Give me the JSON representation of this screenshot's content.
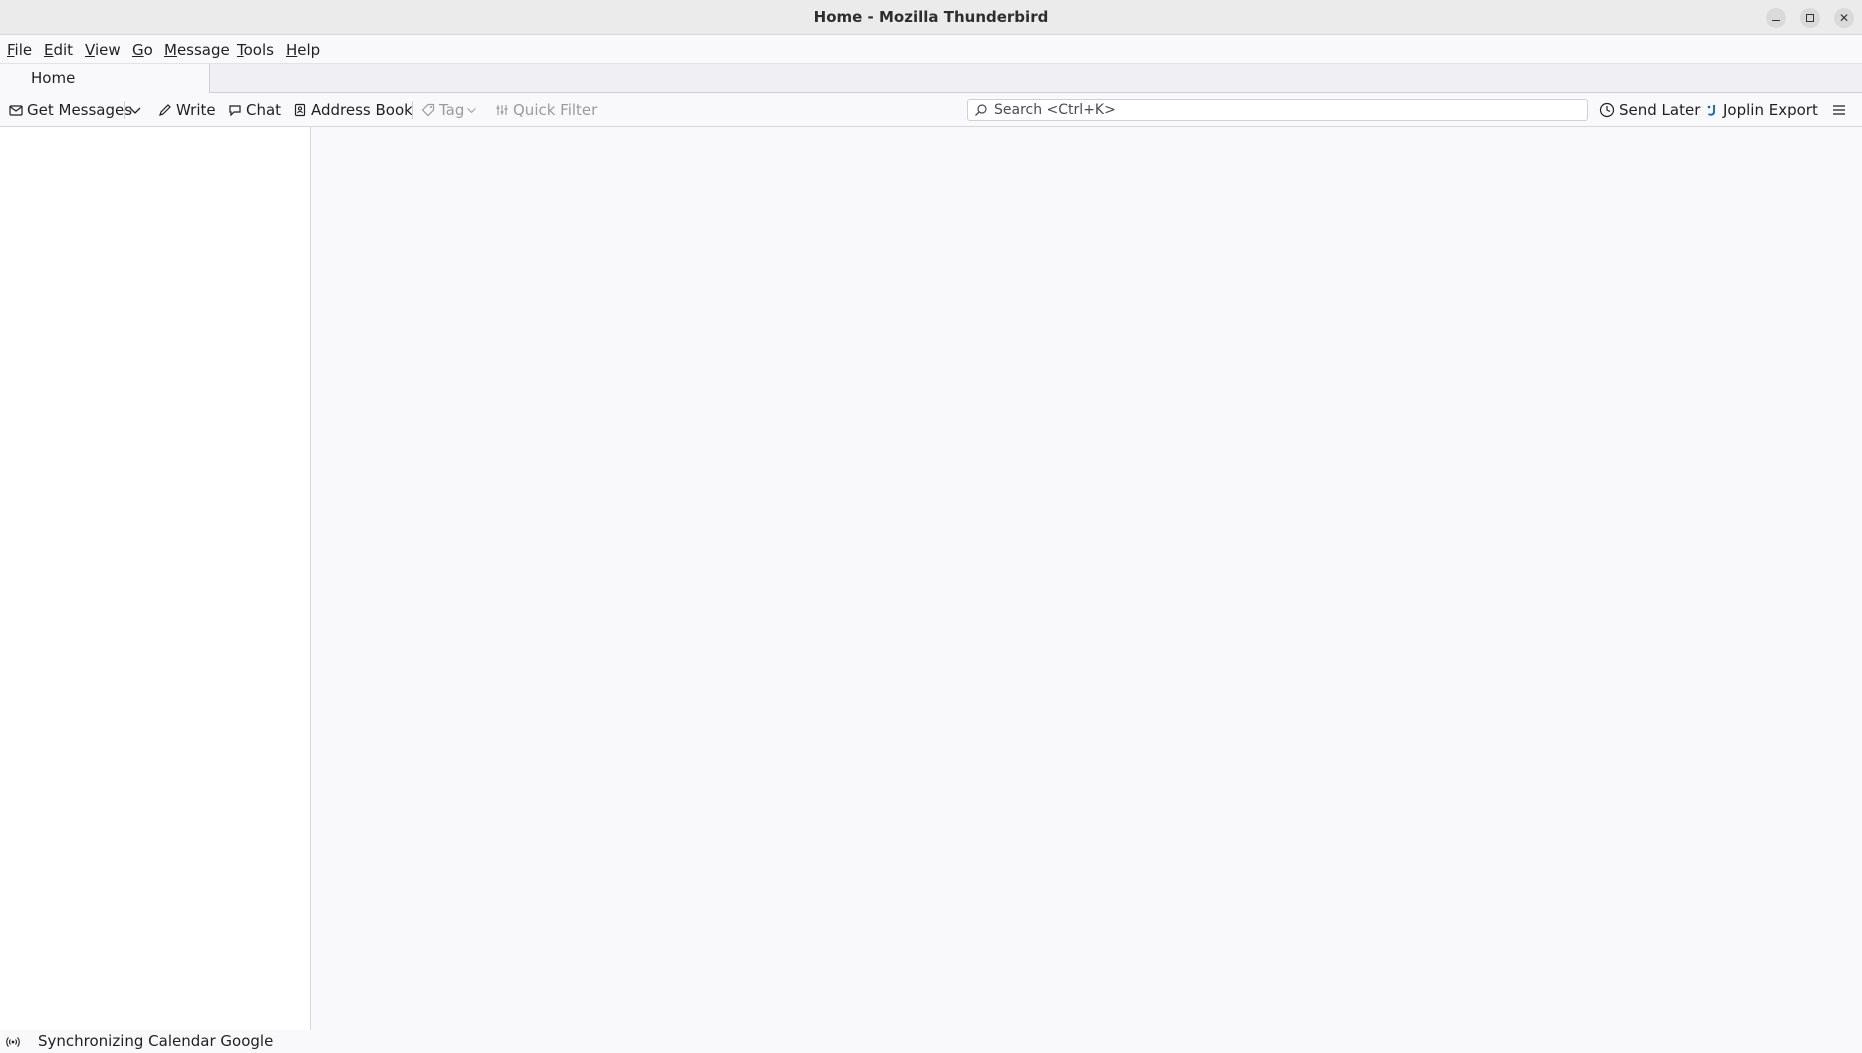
{
  "window": {
    "title": "Home - Mozilla Thunderbird"
  },
  "menubar": {
    "items": [
      {
        "access": "F",
        "rest": "ile"
      },
      {
        "access": "E",
        "rest": "dit"
      },
      {
        "access": "V",
        "rest": "iew"
      },
      {
        "access": "G",
        "rest": "o"
      },
      {
        "access": "M",
        "rest": "essage"
      },
      {
        "access": "T",
        "rest": "ools"
      },
      {
        "access": "H",
        "rest": "elp"
      }
    ]
  },
  "tabs": {
    "home_label": "Home"
  },
  "toolbar": {
    "get_messages": "Get Messages",
    "write": "Write",
    "chat": "Chat",
    "address_book": "Address Book",
    "tag": "Tag",
    "quick_filter": "Quick Filter",
    "send_later": "Send Later",
    "joplin_export": "Joplin Export"
  },
  "search": {
    "placeholder": "Search <Ctrl+K>",
    "value": ""
  },
  "status": {
    "text": "Synchronizing Calendar Google"
  },
  "colors": {
    "accent": "#0060df",
    "disabled_text": "#9a9aa0"
  }
}
